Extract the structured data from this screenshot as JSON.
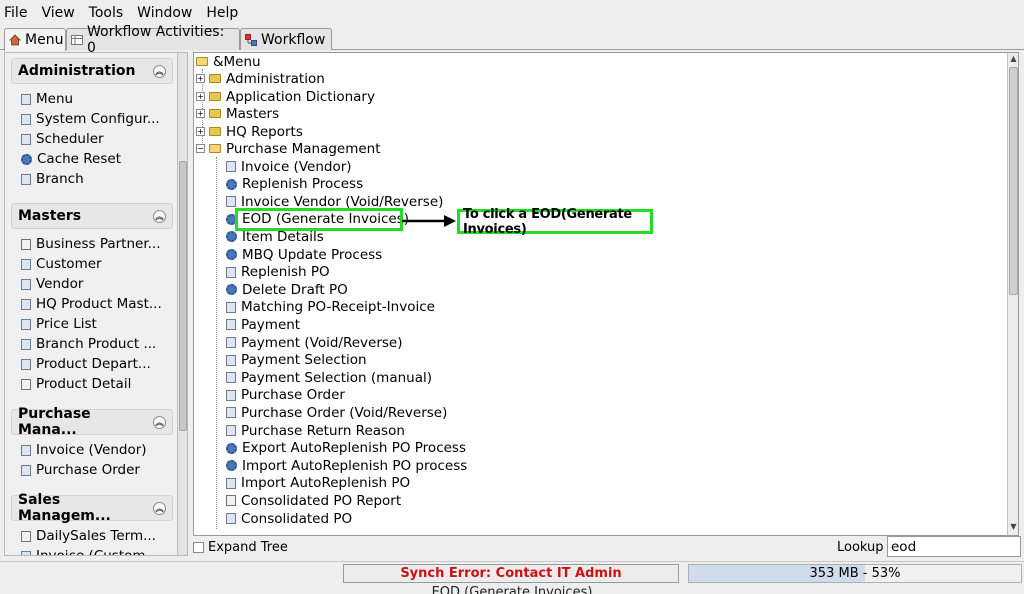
{
  "menubar": {
    "items": [
      "File",
      "View",
      "Tools",
      "Window",
      "Help"
    ]
  },
  "tabs": [
    {
      "label": "Menu",
      "icon": "home-icon"
    },
    {
      "label": "Workflow Activities: 0",
      "icon": "table-icon"
    },
    {
      "label": "Workflow",
      "icon": "workflow-icon"
    }
  ],
  "sidebar": {
    "groups": [
      {
        "title": "Administration",
        "items": [
          "Menu",
          "System Configur...",
          "Scheduler",
          "Cache Reset",
          "Branch"
        ]
      },
      {
        "title": "Masters",
        "items": [
          "Business Partner...",
          "Customer",
          "Vendor",
          "HQ Product Mast...",
          "Price List",
          "Branch Product ...",
          "Product Depart...",
          "Product Detail"
        ]
      },
      {
        "title": "Purchase Mana...",
        "items": [
          "Invoice (Vendor)",
          "Purchase Order"
        ]
      },
      {
        "title": "Sales Managem...",
        "items": [
          "DailySales Term...",
          "Invoice (Custom..."
        ]
      }
    ]
  },
  "tree": {
    "root": "&Menu",
    "folders": [
      "Administration",
      "Application Dictionary",
      "Masters",
      "HQ Reports"
    ],
    "open_folder": "Purchase Management",
    "children": [
      {
        "label": "Invoice (Vendor)",
        "icon": "window-icon"
      },
      {
        "label": "Replenish Process",
        "icon": "process-icon"
      },
      {
        "label": "Invoice Vendor (Void/Reverse)",
        "icon": "window-icon"
      },
      {
        "label": "EOD (Generate Invoices)",
        "icon": "process-icon"
      },
      {
        "label": "Item Details",
        "icon": "process-icon"
      },
      {
        "label": "MBQ Update Process",
        "icon": "process-icon"
      },
      {
        "label": "Replenish PO",
        "icon": "window-icon"
      },
      {
        "label": "Delete Draft PO",
        "icon": "process-icon"
      },
      {
        "label": "Matching PO-Receipt-Invoice",
        "icon": "window-icon"
      },
      {
        "label": "Payment",
        "icon": "window-icon"
      },
      {
        "label": "Payment (Void/Reverse)",
        "icon": "window-icon"
      },
      {
        "label": "Payment Selection",
        "icon": "window-icon"
      },
      {
        "label": "Payment Selection (manual)",
        "icon": "window-icon"
      },
      {
        "label": "Purchase Order",
        "icon": "window-icon"
      },
      {
        "label": "Purchase Order (Void/Reverse)",
        "icon": "window-icon"
      },
      {
        "label": "Purchase Return Reason",
        "icon": "window-icon"
      },
      {
        "label": "Export AutoReplenish PO Process",
        "icon": "process-icon"
      },
      {
        "label": "Import AutoReplenish PO process",
        "icon": "process-icon"
      },
      {
        "label": "Import AutoReplenish PO",
        "icon": "window-icon"
      },
      {
        "label": "Consolidated PO Report",
        "icon": "report-icon"
      },
      {
        "label": "Consolidated PO",
        "icon": "window-icon"
      }
    ]
  },
  "annotation": {
    "callout": "To click a EOD(Generate Invoices)",
    "color": "#22dd22"
  },
  "bottom": {
    "expand_tree": "Expand Tree",
    "lookup_label": "Lookup",
    "lookup_value": "eod"
  },
  "status": {
    "synch_error": "Synch Error: Contact IT Admin",
    "memory": "353 MB - 53%",
    "memory_fraction": 0.53,
    "error_color": "#cc1111"
  },
  "footer": {
    "text": "EOD (Generate Invoices)"
  }
}
